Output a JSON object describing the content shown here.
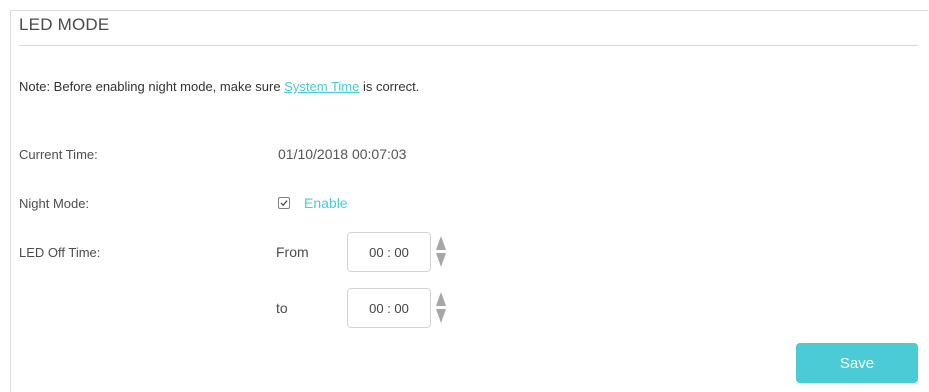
{
  "section": {
    "title": "LED MODE"
  },
  "note": {
    "prefix": "Note: Before enabling night mode, make sure ",
    "link": "System Time",
    "suffix": " is correct."
  },
  "current_time": {
    "label": "Current Time:",
    "value": "01/10/2018 00:07:03"
  },
  "night_mode": {
    "label": "Night Mode:",
    "checkbox_label": "Enable",
    "checked": true
  },
  "led_off_time": {
    "label": "LED Off Time:",
    "from_label": "From",
    "from_value": "00 : 00",
    "to_label": "to",
    "to_value": "00 : 00"
  },
  "actions": {
    "save_label": "Save"
  },
  "colors": {
    "accent": "#4acbd6",
    "text": "#333333",
    "border": "#d4d4d4",
    "stepper": "#a6a6a6"
  },
  "icons": {
    "checkbox": "checkmark-icon",
    "stepper_up": "triangle-up-icon",
    "stepper_down": "triangle-down-icon"
  }
}
